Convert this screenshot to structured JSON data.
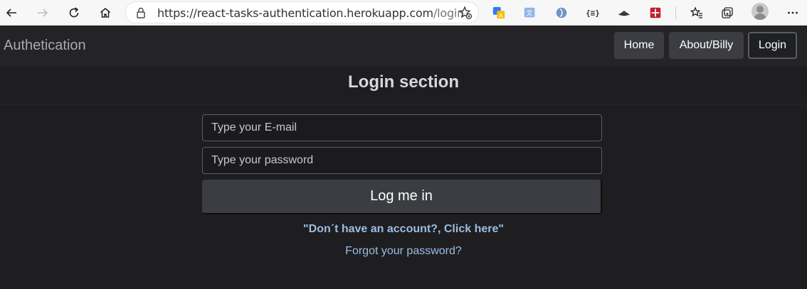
{
  "browser": {
    "url_main": "https://react-tasks-authentication.herokuapp.com",
    "url_path": "/login",
    "icons": [
      "back-arrow-icon",
      "forward-arrow-icon",
      "reload-icon",
      "home-icon",
      "lock-icon",
      "favorite-add-icon",
      "extension-translate-icon",
      "extension-translate2-icon",
      "extension-globe-icon",
      "extension-json-icon",
      "extension-cap-icon",
      "extension-gift-icon",
      "favorites-icon",
      "collections-icon",
      "profile-avatar-icon",
      "more-menu-icon"
    ],
    "ext_json_label": "{≡}"
  },
  "navbar": {
    "brand": "Authetication",
    "links": [
      {
        "label": "Home"
      },
      {
        "label": "About/Billy"
      },
      {
        "label": "Login"
      }
    ],
    "active_link": "Login"
  },
  "main": {
    "title": "Login section",
    "email_placeholder": "Type your E-mail",
    "password_placeholder": "Type your password",
    "submit_label": "Log me in",
    "signup_link": "\"Don´t have an account?, Click here\"",
    "forgot_link": "Forgot your password?"
  },
  "colors": {
    "page_bg": "#1e1e21",
    "navbar_bg": "#242427",
    "button_bg": "#3b3d42",
    "link": "#9bbde0"
  }
}
